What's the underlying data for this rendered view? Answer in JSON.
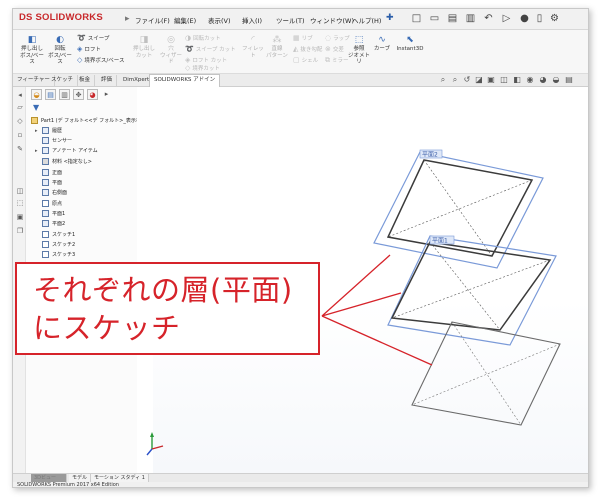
{
  "app": {
    "brand_ds": "DS",
    "brand_name": "SOLIDWORKS"
  },
  "menu": {
    "items": [
      "ファイル(F)",
      "編集(E)",
      "表示(V)",
      "挿入(I)",
      "ツール(T)",
      "ウィンドウ(W)",
      "ヘルプ(H)"
    ]
  },
  "ribbon": {
    "extrude_boss": "押し出し\nボス/ベース",
    "revolve_boss": "回転\nボス/ベース",
    "sweep": "スイープ",
    "loft": "ロフト",
    "boundary_boss": "境界ボス/ベース",
    "extrude_cut": "押し出し\nカット",
    "wizard": "穴\nウィザード",
    "revolve_cut": "回転カット",
    "sweep_cut": "スイープ カット",
    "loft_cut": "ロフト カット",
    "boundary_cut": "境界カット",
    "fillet": "フィレット",
    "linear_pattern": "直線\nパターン",
    "rib": "リブ",
    "draft": "抜き勾配",
    "shell": "シェル",
    "wrap": "ラップ",
    "intersect": "交差",
    "mirror": "ミラー",
    "ref_geometry": "参照\nジオメトリ",
    "curves": "カーブ",
    "instant3d": "Instant3D"
  },
  "tabs": [
    "フィーチャー",
    "スケッチ",
    "板金",
    "評価",
    "DimXpert",
    "SOLIDWORKS アドイン"
  ],
  "tree": {
    "part": "Part1 (デ フォルト<<デ フォルト>_表示状態 1>)",
    "history": "履歴",
    "sensors": "センサー",
    "annotations": "アノテート アイテム",
    "material": "材料 <指定なし>",
    "front_plane": "正面",
    "top_plane": "平面",
    "right_plane": "右側面",
    "origin": "原点",
    "plane1": "平面1",
    "plane2": "平面2",
    "sketch1": "スケッチ1",
    "sketch2": "スケッチ2",
    "sketch3": "スケッチ3"
  },
  "planes": {
    "top_label": "平面2",
    "middle_label": "平面1"
  },
  "bottom_tabs": [
    "3Dビュー",
    "モデル",
    "モーション スタディ 1"
  ],
  "status_bar": "SOLIDWORKS Premium 2017 x64 Edition",
  "callout": {
    "line1": "それぞれの層(平面)",
    "line2": "にスケッチ"
  },
  "colors": {
    "callout_red": "#d6232a",
    "plane_blue": "#7a9ad8",
    "sketch_gray": "#555555",
    "brand_red": "#c8282b"
  }
}
